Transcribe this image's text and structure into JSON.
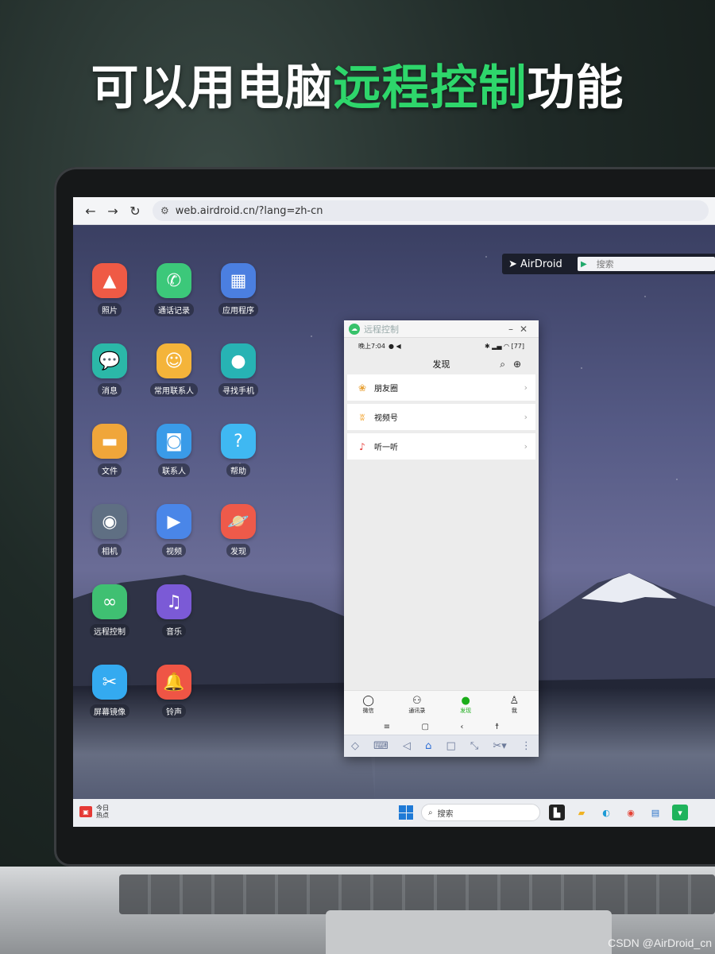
{
  "headline": {
    "part1": "可以用电脑",
    "part2": "远程控制",
    "part3": "功能"
  },
  "browser": {
    "url": "web.airdroid.cn/?lang=zh-cn"
  },
  "airdroid": {
    "logo": "AirDroid",
    "search_placeholder": "搜索"
  },
  "desktop_apps": [
    {
      "label": "照片",
      "icon": "photo-icon",
      "color": "#ef5a45"
    },
    {
      "label": "通话记录",
      "icon": "phone-icon",
      "color": "#3cc87a"
    },
    {
      "label": "应用程序",
      "icon": "apps-grid-icon",
      "color": "#4b7fe0"
    },
    {
      "label": "消息",
      "icon": "message-icon",
      "color": "#2bb8a8"
    },
    {
      "label": "常用联系人",
      "icon": "frequent-contacts-icon",
      "color": "#f4b43a"
    },
    {
      "label": "寻找手机",
      "icon": "location-pin-icon",
      "color": "#27b3b4"
    },
    {
      "label": "文件",
      "icon": "folder-icon",
      "color": "#f0a63a"
    },
    {
      "label": "联系人",
      "icon": "contacts-icon",
      "color": "#3a9be8"
    },
    {
      "label": "帮助",
      "icon": "help-icon",
      "color": "#3fb8f2"
    },
    {
      "label": "相机",
      "icon": "camera-icon",
      "color": "#5f6f83"
    },
    {
      "label": "视频",
      "icon": "video-play-icon",
      "color": "#4a86e8"
    },
    {
      "label": "发现",
      "icon": "planet-icon",
      "color": "#ee5a4a"
    },
    {
      "label": "远程控制",
      "icon": "binoculars-icon",
      "color": "#3fc072"
    },
    {
      "label": "音乐",
      "icon": "music-note-icon",
      "color": "#7b5ad6"
    },
    {
      "label": "屏幕镜像",
      "icon": "scissors-icon",
      "color": "#34aaf0"
    },
    {
      "label": "铃声",
      "icon": "bell-icon",
      "color": "#ef5545"
    }
  ],
  "remote_window": {
    "title": "远程控制",
    "status_time": "晚上7:04",
    "battery": "77",
    "page_title": "发现",
    "items": [
      {
        "label": "朋友圈",
        "icon": "moments-icon"
      },
      {
        "label": "视频号",
        "icon": "channels-icon"
      },
      {
        "label": "听一听",
        "icon": "listen-icon"
      }
    ],
    "tabs": [
      {
        "label": "微信",
        "icon": "chat-bubble-icon"
      },
      {
        "label": "通讯录",
        "icon": "contacts-book-icon"
      },
      {
        "label": "发现",
        "icon": "compass-icon"
      },
      {
        "label": "我",
        "icon": "person-icon"
      }
    ]
  },
  "taskbar": {
    "weather_line1": "今日",
    "weather_line2": "热点",
    "search_label": "搜索"
  },
  "watermark": "CSDN @AirDroid_cn",
  "colors": {
    "accent_green": "#2ed66b",
    "wechat_green": "#1aad19"
  }
}
